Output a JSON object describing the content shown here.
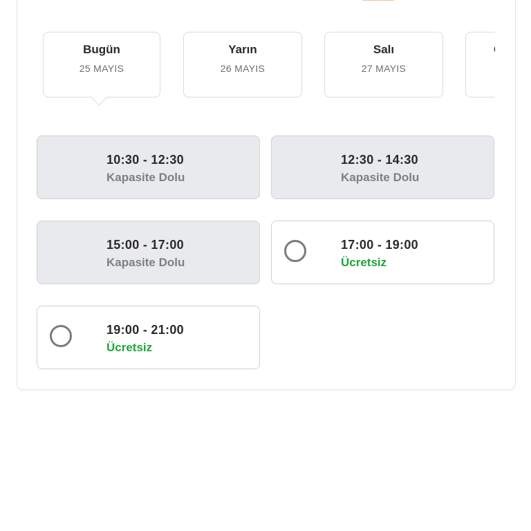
{
  "days": [
    {
      "name": "Bugün",
      "date": "25 MAYIS"
    },
    {
      "name": "Yarın",
      "date": "26 MAYIS"
    },
    {
      "name": "Salı",
      "date": "27 MAYIS"
    },
    {
      "name": "Ç",
      "date": ""
    }
  ],
  "slots": [
    {
      "time": "10:30 - 12:30",
      "status": "Kapasite Dolu"
    },
    {
      "time": "12:30 - 14:30",
      "status": "Kapasite Dolu"
    },
    {
      "time": "15:00 - 17:00",
      "status": "Kapasite Dolu"
    },
    {
      "time": "17:00 - 19:00",
      "status": "Ücretsiz"
    },
    {
      "time": "19:00 - 21:00",
      "status": "Ücretsiz"
    }
  ],
  "colors": {
    "available_text": "#1fa33a",
    "full_background": "#e9eaed",
    "full_text": "#7d7f84",
    "vehicle_accent": "#f07b1a"
  },
  "icons": {
    "vehicle": "delivery-vehicle-icon",
    "radio": "radio-unchecked-icon"
  }
}
